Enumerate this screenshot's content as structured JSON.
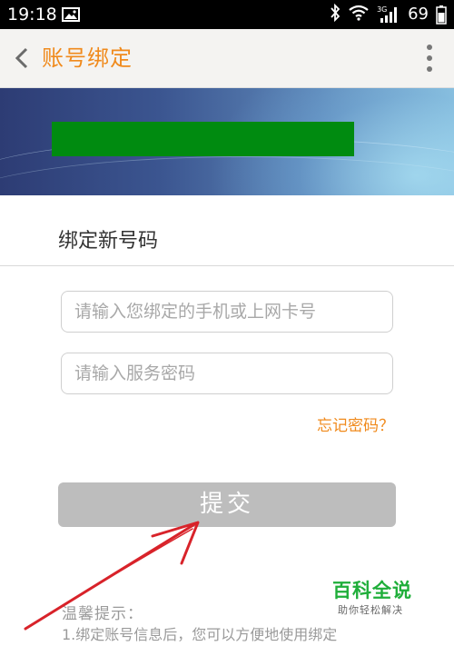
{
  "status_bar": {
    "time": "19:18",
    "signal_badge": "3G",
    "battery_percent": "69",
    "icons": [
      "image-icon",
      "bluetooth-icon",
      "wifi-icon",
      "signal-icon",
      "battery-icon"
    ]
  },
  "app_bar": {
    "title": "账号绑定",
    "back_icon": "chevron-left-icon",
    "menu_icon": "more-vertical-icon",
    "accent_color": "#f08a1c"
  },
  "form": {
    "section_title": "绑定新号码",
    "phone_placeholder": "请输入您绑定的手机或上网卡号",
    "password_placeholder": "请输入服务密码",
    "forgot_password": "忘记密码？",
    "submit_label": "提交"
  },
  "tips": {
    "title": "温馨提示：",
    "line1": "1.绑定账号信息后，您可以方便地使用绑定"
  },
  "watermark": {
    "title": "百科全说",
    "subtitle": "助你轻松解决"
  },
  "colors": {
    "banner_block": "#008b10",
    "submit_bg": "#bdbdbd",
    "annotation_arrow": "#d8232a",
    "watermark": "#1fae3a"
  }
}
